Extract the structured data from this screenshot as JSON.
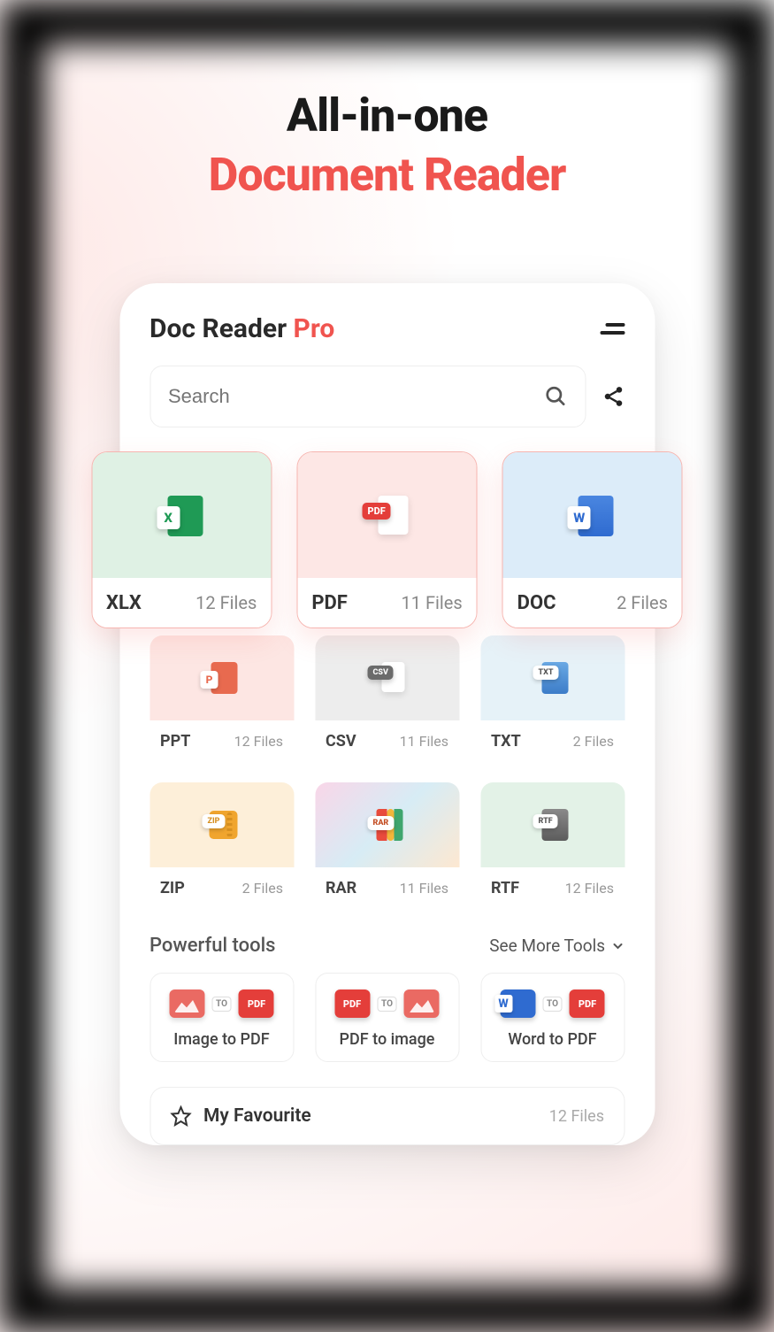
{
  "headline": {
    "line1": "All-in-one",
    "line2": "Document Reader"
  },
  "app": {
    "title": "Doc Reader ",
    "title_suffix": "Pro"
  },
  "search": {
    "placeholder": "Search"
  },
  "big_cards": [
    {
      "name": "XLX",
      "count": "12 Files",
      "bg": "bg-green",
      "icon": "xlx"
    },
    {
      "name": "PDF",
      "count": "11 Files",
      "bg": "bg-red",
      "icon": "pdf"
    },
    {
      "name": "DOC",
      "count": "2 Files",
      "bg": "bg-blue",
      "icon": "doc"
    }
  ],
  "small_cards": [
    {
      "name": "PPT",
      "count": "12 Files",
      "bg": "bg-ored",
      "icon": "ppt"
    },
    {
      "name": "CSV",
      "count": "11 Files",
      "bg": "bg-gray",
      "icon": "csv"
    },
    {
      "name": "TXT",
      "count": "2 Files",
      "bg": "bg-lblue",
      "icon": "txt"
    },
    {
      "name": "ZIP",
      "count": "2 Files",
      "bg": "bg-orange",
      "icon": "zip"
    },
    {
      "name": "RAR",
      "count": "11 Files",
      "bg": "bg-grad",
      "icon": "rar"
    },
    {
      "name": "RTF",
      "count": "12 Files",
      "bg": "bg-lgreen",
      "icon": "rtf"
    }
  ],
  "tools": {
    "section_title": "Powerful tools",
    "see_more": "See More Tools",
    "to_label": "TO",
    "items": [
      {
        "label": "Image to PDF",
        "left": "img",
        "right": "pdf"
      },
      {
        "label": "PDF to image",
        "left": "pdf",
        "right": "img"
      },
      {
        "label": "Word to PDF",
        "left": "doc",
        "right": "pdf"
      }
    ]
  },
  "favourite": {
    "title": "My Favourite",
    "count": "12 Files"
  }
}
